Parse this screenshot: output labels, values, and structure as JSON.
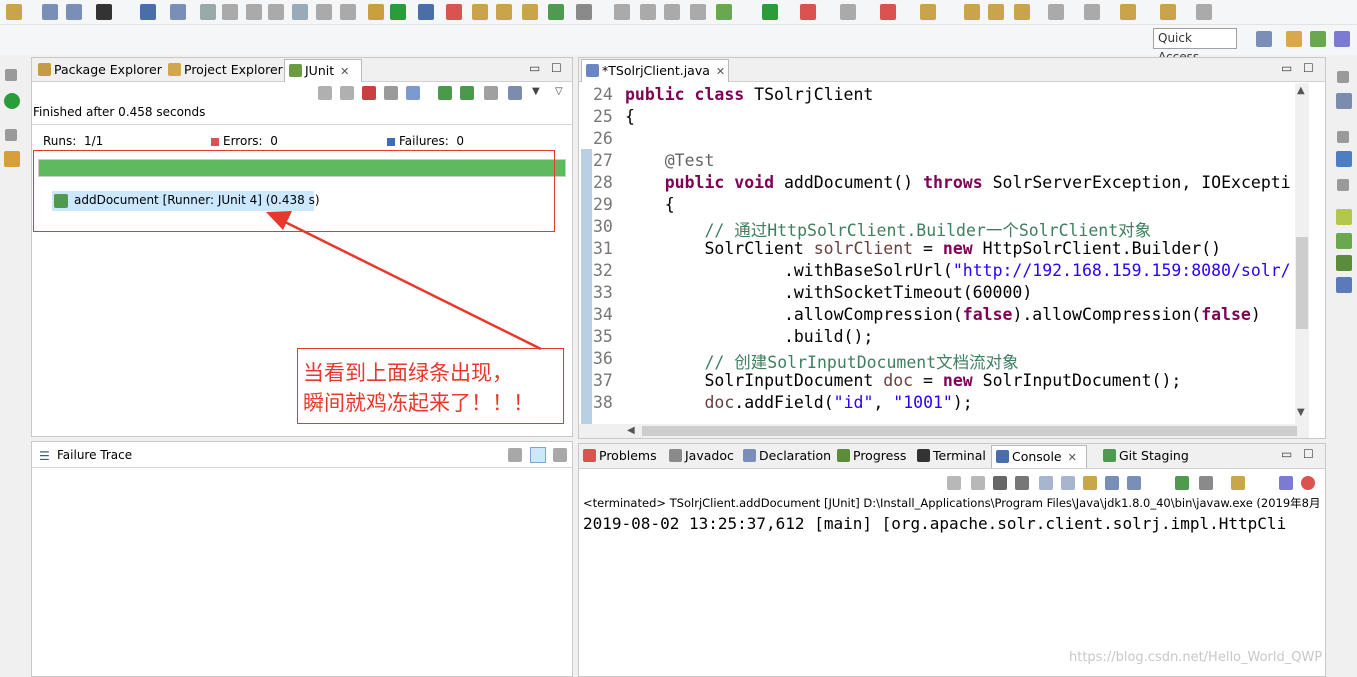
{
  "toolbar": {
    "quick_access": "Quick Access"
  },
  "left_tabs": [
    {
      "label": "Package Explorer"
    },
    {
      "label": "Project Explorer"
    },
    {
      "label": "JUnit"
    }
  ],
  "junit": {
    "finished": "Finished after 0.458 seconds",
    "runs_label": "Runs:",
    "runs_value": "1/1",
    "errors_label": "Errors:",
    "errors_value": "0",
    "failures_label": "Failures:",
    "failures_value": "0",
    "progress_fraction": 1.0,
    "test_item": "addDocument [Runner: JUnit 4] (0.438 s)",
    "failure_trace": "Failure Trace"
  },
  "annotation": {
    "line1": "当看到上面绿条出现，",
    "line2": "瞬间就鸡冻起来了！！！"
  },
  "editor": {
    "tab_label": "*TSolrjClient.java",
    "lines": [
      {
        "n": "24",
        "html": "<span class=\"kw\">public</span> <span class=\"kw\">class</span> TSolrjClient"
      },
      {
        "n": "25",
        "html": "{"
      },
      {
        "n": "26",
        "html": ""
      },
      {
        "n": "27",
        "html": "    <span class=\"an\">@Test</span>"
      },
      {
        "n": "28",
        "html": "    <span class=\"kw\">public</span> <span class=\"kw\">void</span> addDocument() <span class=\"kw\">throws</span> SolrServerException, IOExcepti"
      },
      {
        "n": "29",
        "html": "    {"
      },
      {
        "n": "30",
        "html": "        <span class=\"cm\">// 通过HttpSolrClient.Builder一个SolrClient对象</span>"
      },
      {
        "n": "31",
        "html": "        SolrClient <span class=\"var\">solrClient</span> = <span class=\"kw\">new</span> HttpSolrClient.Builder()"
      },
      {
        "n": "32",
        "html": "                .withBaseSolrUrl(<span class=\"str\">\"http://192.168.159.159:8080/solr/</span>"
      },
      {
        "n": "33",
        "html": "                .withSocketTimeout(60000)"
      },
      {
        "n": "34",
        "html": "                .allowCompression(<span class=\"kw\">false</span>).allowCompression(<span class=\"kw\">false</span>)"
      },
      {
        "n": "35",
        "html": "                .build();"
      },
      {
        "n": "36",
        "html": "        <span class=\"cm\">// 创建SolrInputDocument文档流对象</span>"
      },
      {
        "n": "37",
        "html": "        SolrInputDocument <span class=\"var\">doc</span> = <span class=\"kw\">new</span> SolrInputDocument();"
      },
      {
        "n": "38",
        "html": "        <span class=\"var\">doc</span>.addField(<span class=\"str\">\"id\"</span>, <span class=\"str\">\"1001\"</span>);"
      }
    ]
  },
  "bottom_tabs": [
    {
      "label": "Problems"
    },
    {
      "label": "Javadoc"
    },
    {
      "label": "Declaration"
    },
    {
      "label": "Progress"
    },
    {
      "label": "Terminal"
    },
    {
      "label": "Console"
    },
    {
      "label": "Git Staging"
    }
  ],
  "console": {
    "terminated": "<terminated> TSolrjClient.addDocument [JUnit] D:\\Install_Applications\\Program Files\\Java\\jdk1.8.0_40\\bin\\javaw.exe (2019年8月",
    "output": "2019-08-02 13:25:37,612 [main] [org.apache.solr.client.solrj.impl.HttpCli"
  },
  "watermark": "https://blog.csdn.net/Hello_World_QWP",
  "colors": {
    "junit_green": "#5fb95f",
    "annotation_red": "#e8382b",
    "selection": "#cce8ff"
  }
}
